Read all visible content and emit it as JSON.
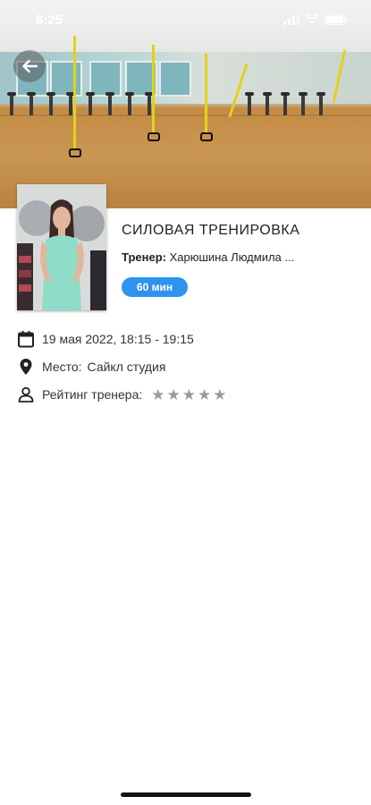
{
  "status_bar": {
    "time": "8:25"
  },
  "class_info": {
    "title": "СИЛОВАЯ ТРЕНИРОВКА",
    "trainer_label": "Тренер:",
    "trainer_name": "Харюшина Людмила ...",
    "duration": "60 мин"
  },
  "details": {
    "datetime": "19 мая 2022, 18:15 - 19:15",
    "place_label": "Место:",
    "place_value": "Сайкл студия",
    "rating_label": "Рейтинг тренера:",
    "rating_value": 0,
    "rating_max": 5
  },
  "icons": {
    "back": "arrow-left-icon",
    "date": "calendar-icon",
    "place": "location-pin-icon",
    "rating": "person-icon",
    "star": "star-icon"
  },
  "colors": {
    "accent": "#2e93ee",
    "star_inactive": "#9a9a9a"
  }
}
